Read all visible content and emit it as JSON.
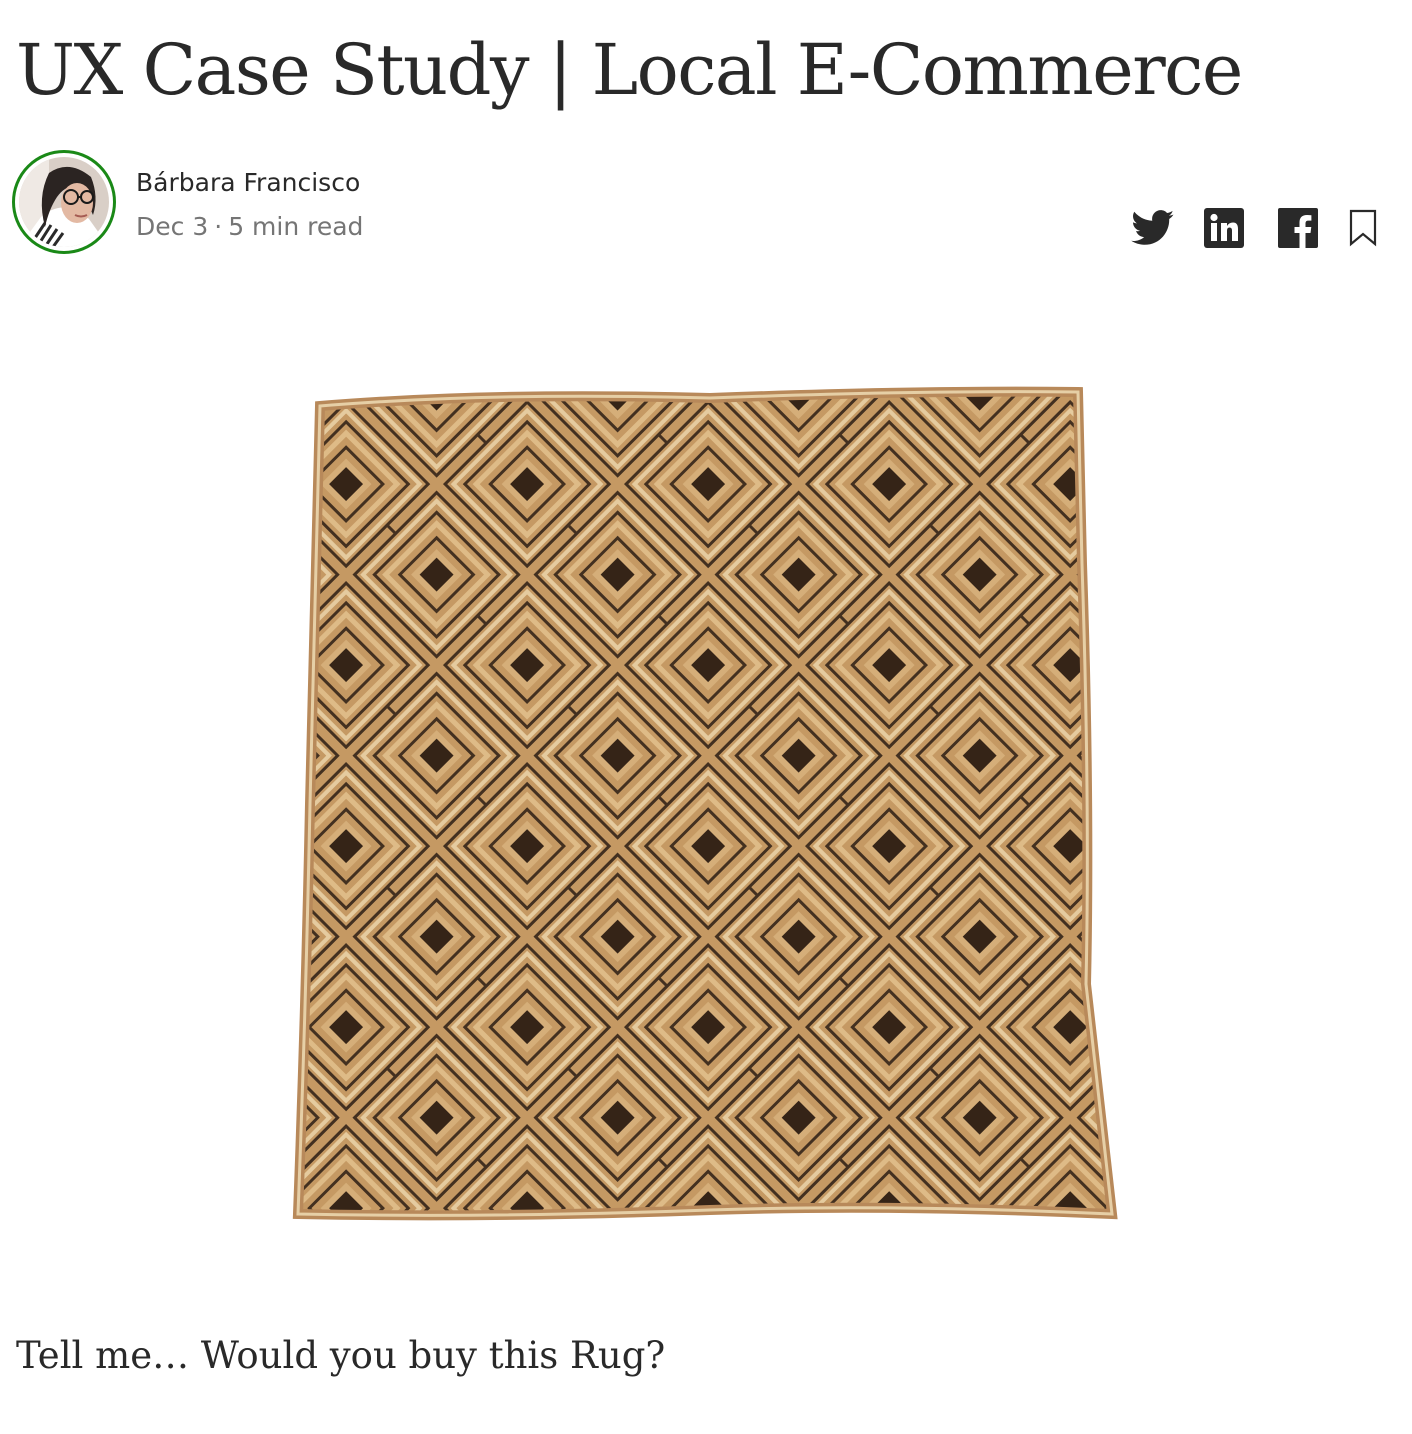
{
  "article": {
    "title": "UX Case Study | Local E-Commerce",
    "author": {
      "name": "Bárbara Francisco",
      "avatar_icon": "avatar-photo",
      "ring_color": "#1a8917"
    },
    "meta": {
      "date": "Dec 3",
      "separator": "·",
      "read_time": "5 min read"
    },
    "share": {
      "icons": [
        "twitter-icon",
        "linkedin-icon",
        "facebook-icon",
        "bookmark-icon"
      ]
    },
    "hero_image": {
      "subject": "woven geometric rug"
    },
    "body": {
      "first_paragraph": "Tell me… Would you buy this Rug?"
    }
  },
  "colors": {
    "text": "#292929",
    "muted": "#757575",
    "rug_base": "#c9a06a",
    "rug_dark": "#2b1d14",
    "rug_light": "#ead2a8"
  }
}
